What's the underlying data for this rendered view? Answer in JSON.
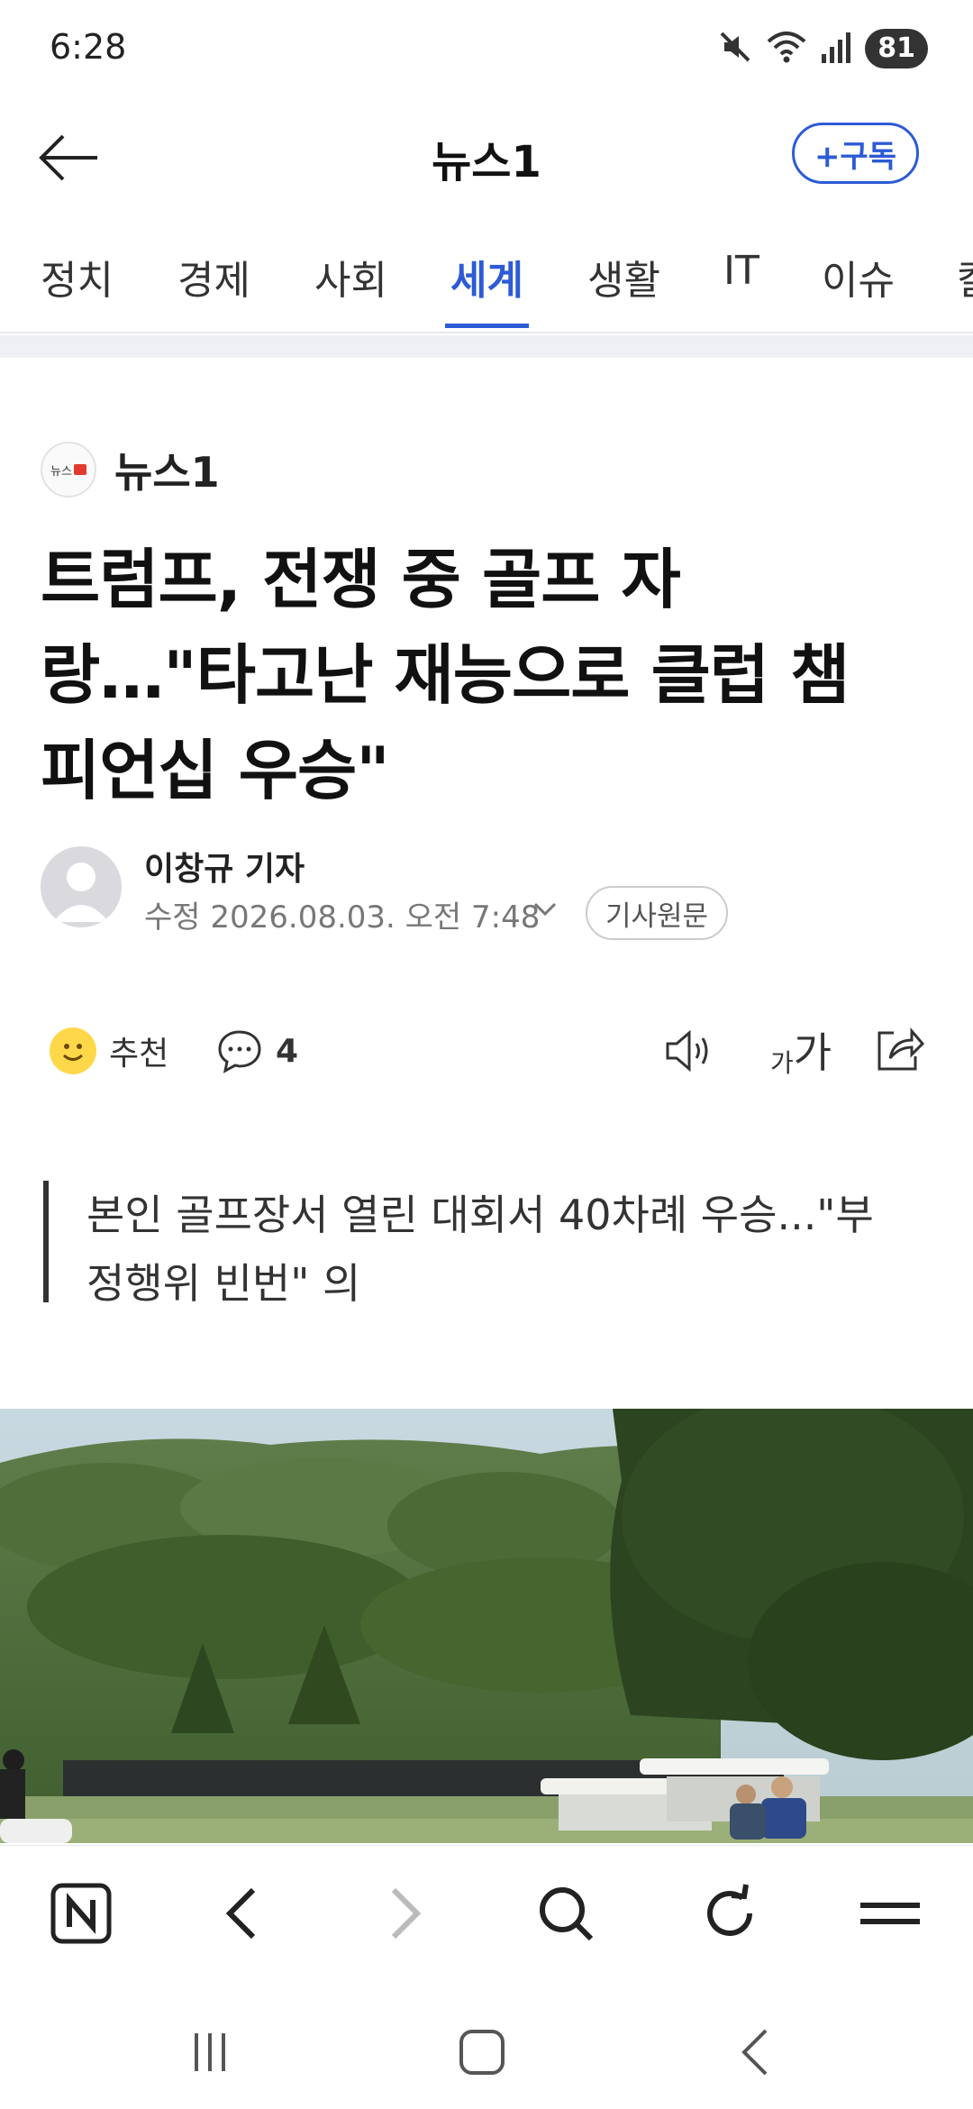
{
  "status": {
    "time": "6:28",
    "battery": "81"
  },
  "header": {
    "title": "뉴스1",
    "subscribe_label": "+구독"
  },
  "tabs": [
    {
      "label": "정치"
    },
    {
      "label": "경제"
    },
    {
      "label": "사회"
    },
    {
      "label": "세계",
      "active": true
    },
    {
      "label": "생활"
    },
    {
      "label": "IT"
    },
    {
      "label": "이슈"
    },
    {
      "label": "칼"
    }
  ],
  "article": {
    "press_name": "뉴스1",
    "press_logo_text": "뉴스",
    "headline_lines": [
      "트럼프, 전쟁 중 골프 자",
      "랑…\"타고난 재능으로 클럽 챔",
      "피언십 우승\""
    ],
    "author": "이창규 기자",
    "edit_date": "수정  2026.08.03. 오전 7:48",
    "original_label": "기사원문",
    "recommend_label": "추천",
    "comment_count": "4",
    "font_small": "가",
    "font_big": "가",
    "summary_lines": [
      "본인 골프장서 열린 대회서 40차례 우승...\"부",
      "정행위 빈번\" 의"
    ]
  },
  "colors": {
    "accent": "#2d5bd6",
    "text": "#111111",
    "muted": "#777777"
  },
  "icons": {
    "status": [
      "mute-icon",
      "wifi-icon",
      "signal-icon"
    ],
    "browser_bar": [
      "naver-home-icon",
      "back-icon",
      "forward-icon",
      "search-icon",
      "refresh-icon",
      "menu-icon"
    ],
    "system_nav": [
      "recents-icon",
      "home-icon",
      "system-back-icon"
    ]
  }
}
